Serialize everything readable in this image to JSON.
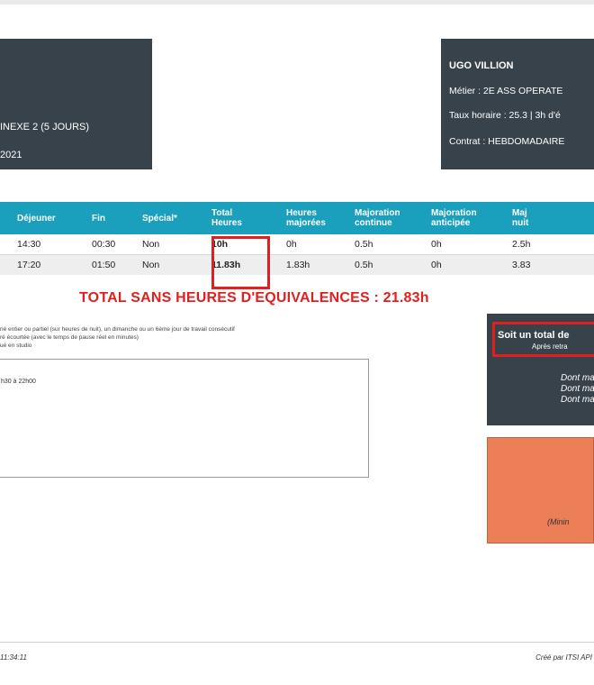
{
  "header_left": {
    "line1": "INEXE 2 (5 JOURS)",
    "line2": "2021"
  },
  "header_right": {
    "name": "UGO VILLION",
    "metier": "Métier : 2E ASS OPERATE",
    "taux": "Taux horaire : 25.3 | 3h d'é",
    "contrat": "Contrat : HEBDOMADAIRE"
  },
  "table": {
    "columns": [
      "Déjeuner",
      "Fin",
      "Spécial*",
      "Total\nHeures",
      "Heures\nmajorées",
      "Majoration\ncontinue",
      "Majoration\nanticipée",
      "Maj\nnuit"
    ],
    "rows": [
      {
        "dejeuner": "14:30",
        "fin": "00:30",
        "special": "Non",
        "total": "10h",
        "majorees": "0h",
        "continue": "0.5h",
        "anticipee": "0h",
        "nuit": "2.5h"
      },
      {
        "dejeuner": "17:20",
        "fin": "01:50",
        "special": "Non",
        "total": "11.83h",
        "majorees": "1.83h",
        "continue": "0.5h",
        "anticipee": "0h",
        "nuit": "3.83"
      }
    ]
  },
  "total_line": "TOTAL SANS HEURES D'EQUIVALENCES : 21.83h",
  "notes": [
    "rié entier ou partiel (sur heures de nuit), un dimanche ou un 6ème jour de travail consécutif",
    "ré écourtée (avec le temps de pause réel en minutes)",
    "ué en studio"
  ],
  "comment_text": "h30 à 22h00",
  "summary": {
    "title": "Soit un total de",
    "subtitle": "Après retra",
    "dont": [
      "Dont ma",
      "Dont ma",
      "Dont ma"
    ]
  },
  "orange": {
    "text": "(Minin"
  },
  "footer": {
    "left": "11:34:11",
    "right": "Créé par ITSI API"
  },
  "colors": {
    "header": "#1aa0bd",
    "panel": "#37424a",
    "accent_red": "#e02020",
    "orange": "#ec7e58"
  }
}
